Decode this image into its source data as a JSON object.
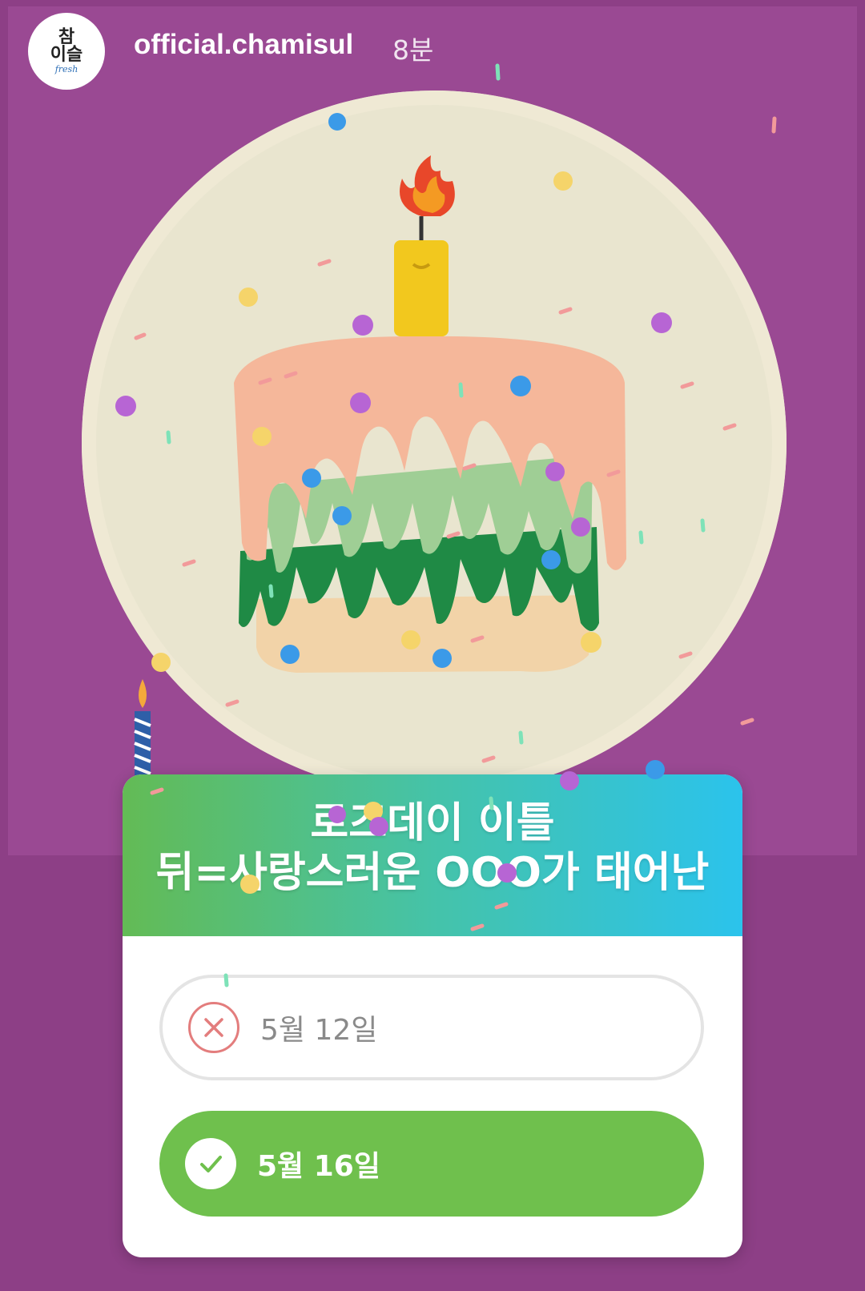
{
  "account": {
    "username": "official.chamisul",
    "time_ago": "8분",
    "avatar_logo_top": "참",
    "avatar_logo_bottom": "이슬",
    "avatar_logo_sub": "fresh"
  },
  "quiz": {
    "question": "로즈데이 이틀\n뒤=사랑스러운 OOO가 태어난",
    "options": [
      {
        "label": "5월 12일",
        "state": "wrong",
        "icon": "close-icon"
      },
      {
        "label": "5월 16일",
        "state": "correct",
        "icon": "check-icon"
      }
    ]
  },
  "colors": {
    "background": "#8d3f86",
    "correct": "#6fc04d",
    "wrong": "#e37d7d",
    "header_gradient_start": "#63bb55",
    "header_gradient_end": "#2bc3ec"
  }
}
